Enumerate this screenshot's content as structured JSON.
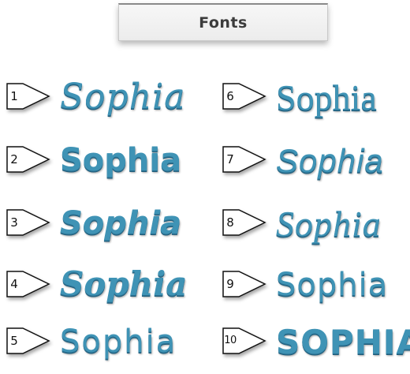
{
  "title": "Fonts",
  "colors": {
    "text": "#3f93b5",
    "marker_fill": "#ffffff",
    "marker_stroke": "#111111"
  },
  "items": [
    {
      "number": "1",
      "name": "Sophia"
    },
    {
      "number": "2",
      "name": "Sophia"
    },
    {
      "number": "3",
      "name": "Sophia"
    },
    {
      "number": "4",
      "name": "Sophia"
    },
    {
      "number": "5",
      "name": "Sophia"
    },
    {
      "number": "6",
      "name": "Sophia"
    },
    {
      "number": "7",
      "name": "Sophia"
    },
    {
      "number": "8",
      "name": "Sophia"
    },
    {
      "number": "9",
      "name": "Sophia"
    },
    {
      "number": "10",
      "name": "SOPHIA"
    }
  ]
}
